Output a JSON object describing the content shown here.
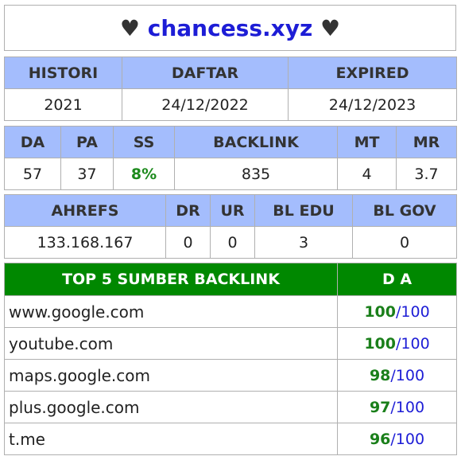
{
  "title": {
    "heart_left": "♥",
    "domain": "chancess.xyz",
    "heart_right": "♥"
  },
  "history": {
    "headers": [
      "HISTORI",
      "DAFTAR",
      "EXPIRED"
    ],
    "values": [
      "2021",
      "24/12/2022",
      "24/12/2023"
    ]
  },
  "metrics": {
    "headers": [
      "DA",
      "PA",
      "SS",
      "BACKLINK",
      "MT",
      "MR"
    ],
    "values": [
      "57",
      "37",
      "8%",
      "835",
      "4",
      "3.7"
    ]
  },
  "ahrefs": {
    "headers": [
      "AHREFS",
      "DR",
      "UR",
      "BL EDU",
      "BL GOV"
    ],
    "values": [
      "133.168.167",
      "0",
      "0",
      "3",
      "0"
    ]
  },
  "backlinks": {
    "header_source": "TOP 5 SUMBER BACKLINK",
    "header_da": "D A",
    "max": "100",
    "slash": "/",
    "rows": [
      {
        "site": "www.google.com",
        "da": "100"
      },
      {
        "site": "youtube.com",
        "da": "100"
      },
      {
        "site": "maps.google.com",
        "da": "98"
      },
      {
        "site": "plus.google.com",
        "da": "97"
      },
      {
        "site": "t.me",
        "da": "96"
      }
    ]
  }
}
